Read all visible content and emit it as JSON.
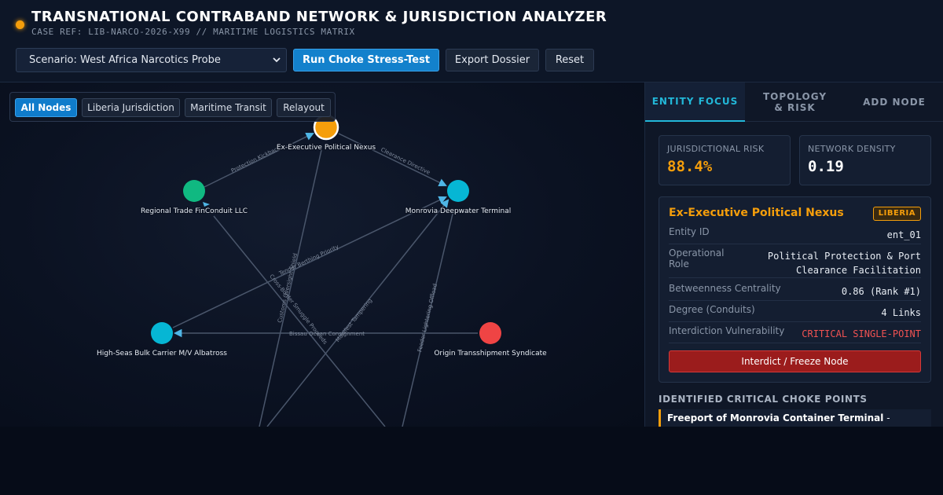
{
  "header": {
    "title": "TRANSNATIONAL CONTRABAND NETWORK & JURISDICTION ANALYZER",
    "subtitle": "CASE REF: LIB-NARCO-2026-X99 // MARITIME LOGISTICS MATRIX",
    "scenario_value": "Scenario: West Africa Narcotics Probe",
    "run_label": "Run Choke Stress-Test",
    "export_label": "Export Dossier",
    "reset_label": "Reset"
  },
  "filters": [
    "All Nodes",
    "Liberia Jurisdiction",
    "Maritime Transit",
    "Relayout"
  ],
  "graph": {
    "nodes": [
      {
        "id": "n1",
        "label": "Ex-Executive Political Nexus",
        "color": "#f59e0b"
      },
      {
        "id": "n2",
        "label": "Regional Trade FinConduit LLC",
        "color": "#10b981"
      },
      {
        "id": "n3",
        "label": "Monrovia Deepwater Terminal",
        "color": "#06b6d4"
      },
      {
        "id": "n4",
        "label": "High-Seas Bulk Carrier M/V Albatross",
        "color": "#06b6d4"
      },
      {
        "id": "n5",
        "label": "Origin Transshipment Syndicate",
        "color": "#ef4444"
      }
    ],
    "edge_labels": [
      "Protection Kickbacks",
      "Clearance Directive",
      "Tender Berthing Priority",
      "Customs Oversight Shield",
      "Cross-Border Smuggle Proceeds",
      "Manifest Tampering",
      "Feeder Lightering Offload",
      "Bissau Ocean Consignment"
    ]
  },
  "tabs": [
    "ENTITY FOCUS",
    "TOPOLOGY & RISK",
    "ADD NODE"
  ],
  "metrics": {
    "risk_label": "JURISDICTIONAL RISK",
    "risk_value": "88.4%",
    "density_label": "NETWORK DENSITY",
    "density_value": "0.19"
  },
  "entity": {
    "name": "Ex-Executive Political Nexus",
    "badge": "LIBERIA",
    "rows": [
      {
        "label": "Entity ID",
        "value": "ent_01"
      },
      {
        "label": "Operational Role",
        "value": "Political Protection & Port Clearance Facilitation"
      },
      {
        "label": "Betweenness Centrality",
        "value": "0.86 (Rank #1)"
      },
      {
        "label": "Degree (Conduits)",
        "value": "4 Links"
      },
      {
        "label": "Interdiction Vulnerability",
        "value": "CRITICAL SINGLE-POINT"
      }
    ],
    "freeze_label": "Interdict / Freeze Node"
  },
  "choke": {
    "heading": "IDENTIFIED CRITICAL CHOKE POINTS",
    "item_name": "Freeport of Monrovia Container Terminal",
    "item_suffix": " -"
  },
  "colors": {
    "accent": "#22b7d8",
    "warning": "#f59e0b",
    "danger": "#ef4444",
    "primary": "#1381cc"
  }
}
